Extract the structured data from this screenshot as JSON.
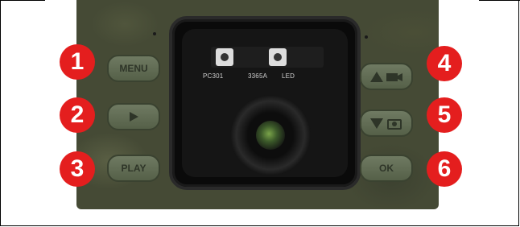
{
  "buttons": {
    "menu": {
      "label": "MENU",
      "callout": "1"
    },
    "right": {
      "label": "",
      "callout": "2"
    },
    "play": {
      "label": "PLAY",
      "callout": "3"
    },
    "up": {
      "label": "",
      "callout": "4"
    },
    "down": {
      "label": "",
      "callout": "5"
    },
    "ok": {
      "label": "OK",
      "callout": "6"
    }
  },
  "pcb": {
    "label_left": "PC301",
    "label_mid": "3365A",
    "label_right": "LED"
  },
  "icons": {
    "right": "play-triangle-icon",
    "up": "up-triangle-video-icon",
    "down": "down-triangle-camera-icon"
  },
  "colors": {
    "callout_red": "#e41e1e",
    "button_green": "#6f7a62",
    "camo_base": "#454a35"
  }
}
